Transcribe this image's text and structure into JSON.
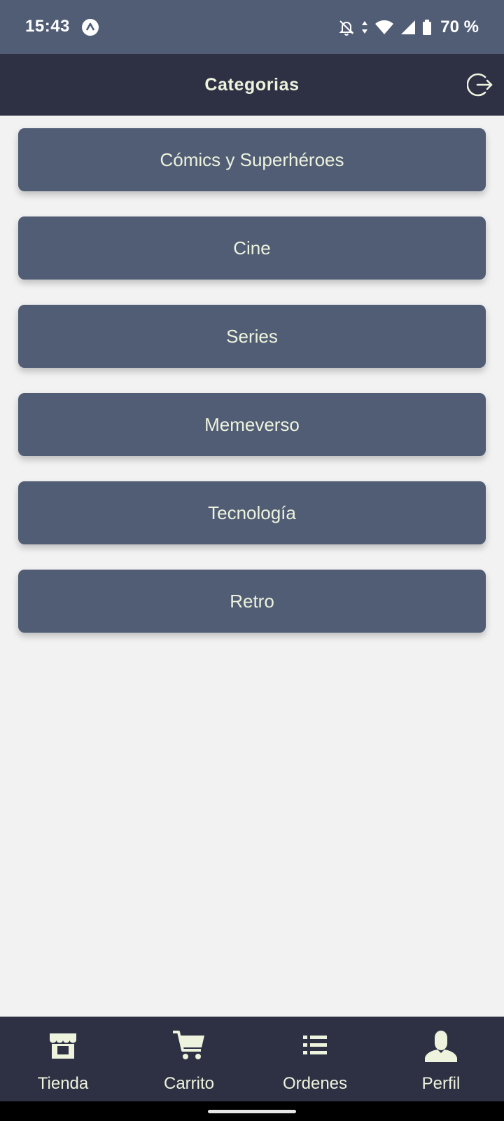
{
  "status_bar": {
    "time": "15:43",
    "battery": "70 %",
    "icons": [
      "app-notification-icon",
      "bell-off-icon",
      "data-arrows-icon",
      "wifi-icon",
      "signal-icon",
      "battery-icon"
    ]
  },
  "header": {
    "title": "Categorias",
    "logout_icon": "logout-icon"
  },
  "categories": [
    {
      "label": "Cómics y Superhéroes"
    },
    {
      "label": "Cine"
    },
    {
      "label": "Series"
    },
    {
      "label": "Memeverso"
    },
    {
      "label": "Tecnología"
    },
    {
      "label": "Retro"
    }
  ],
  "bottom_nav": [
    {
      "label": "Tienda",
      "icon": "store-icon"
    },
    {
      "label": "Carrito",
      "icon": "cart-icon"
    },
    {
      "label": "Ordenes",
      "icon": "list-icon"
    },
    {
      "label": "Perfil",
      "icon": "user-icon"
    }
  ],
  "colors": {
    "status_bar": "#505d75",
    "header": "#2e3144",
    "card": "#505d75",
    "text_accent": "#eef3dd",
    "background": "#f2f2f2"
  }
}
